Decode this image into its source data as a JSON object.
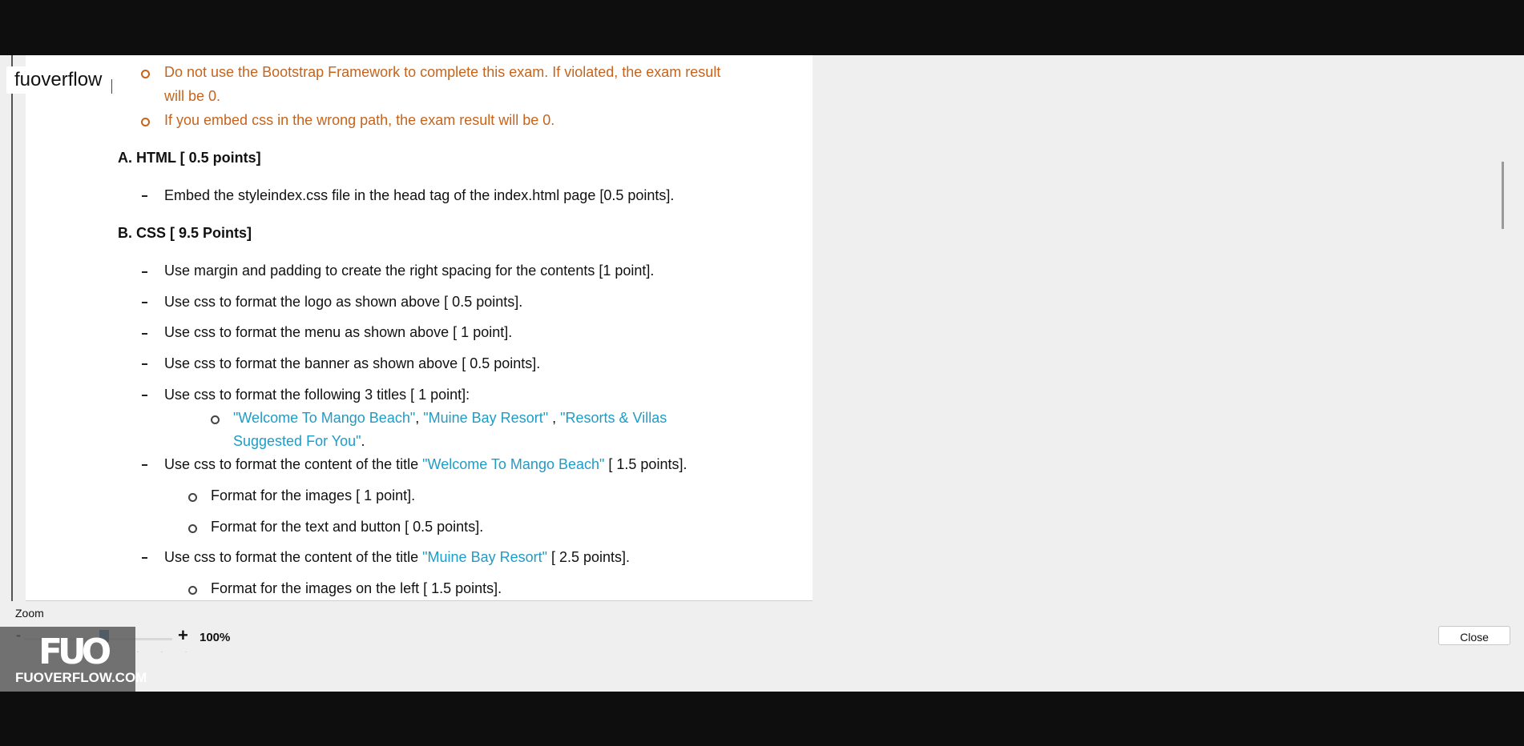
{
  "viewer": {
    "tab_label": "fuoverflow"
  },
  "document": {
    "notes": [
      {
        "text_line1": "Do not use the Bootstrap Framework to complete this exam. If violated, the exam result",
        "text_line2": "will be 0."
      },
      {
        "text": "If you embed css in the wrong path, the exam result will be 0."
      }
    ],
    "section_a": {
      "title": "A. HTML  [ 0.5 points]",
      "items": [
        "Embed the styleindex.css file in the head tag of the index.html page [0.5 points]."
      ]
    },
    "section_b": {
      "title": "B. CSS  [  9.5 Points]",
      "items": [
        "Use margin and padding to create the right spacing for the contents [1 point].",
        "Use css to format the logo as shown above [ 0.5 points].",
        "Use css to format the menu as shown above [ 1 point].",
        "Use css to format the banner as shown above [ 0.5 points].",
        "Use css to format the following 3 titles [ 1 point]:"
      ],
      "titles_sub": {
        "t1": "\"Welcome To Mango Beach\"",
        "sep1": ", ",
        "t2": "\"Muine Bay Resort\"",
        "sep2": " , ",
        "t3a": "\"Resorts & Villas",
        "t3b": "Suggested For You\"",
        "end": "."
      },
      "item_mango": {
        "pre": "Use css to format the content of the title ",
        "title": "\"Welcome To Mango Beach\"",
        "post": " [ 1.5 points]."
      },
      "mango_sub": [
        "Format for the images [ 1 point].",
        "Format for the text and button [ 0.5 points]."
      ],
      "item_muine": {
        "pre": "Use css to format the content of the title ",
        "title": "\"Muine Bay Resort\"",
        "post": " [ 2.5 points]."
      },
      "muine_sub": [
        "Format for the images  on the left [ 1.5 points]."
      ]
    }
  },
  "controls": {
    "zoom_label": "Zoom",
    "zoom_minus": "-",
    "zoom_plus": "+",
    "zoom_value": "100%",
    "zoom_level_percent": 100,
    "close_label": "Close"
  },
  "watermark": {
    "logo": "FUO",
    "text": "FUOVERFLOW.COM"
  },
  "colors": {
    "warning_text": "#c6641d",
    "title_highlight": "#1f9cc6",
    "zoom_thumb": "#1e5eaa"
  }
}
